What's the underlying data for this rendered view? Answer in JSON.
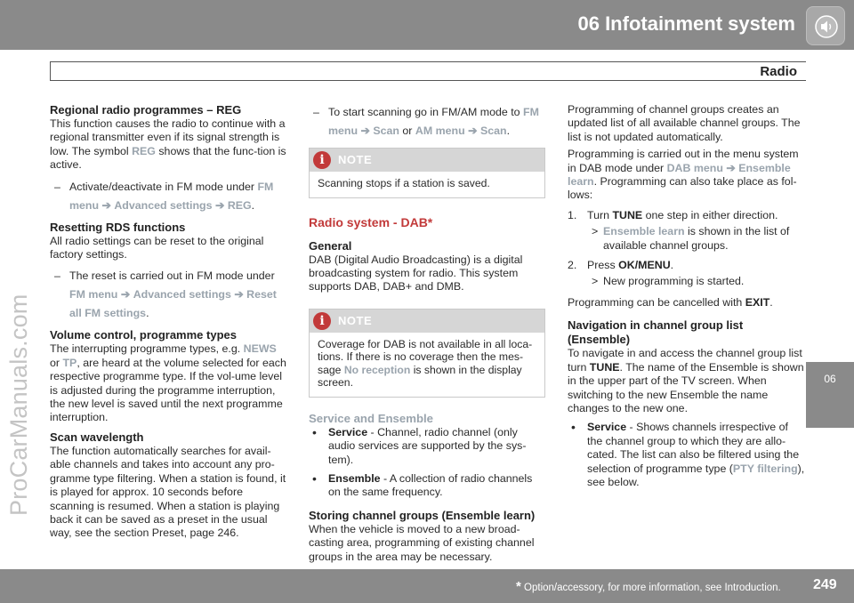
{
  "header": {
    "chapter_title": "06 Infotainment system",
    "icon": "speaker-icon"
  },
  "section": {
    "title": "Radio"
  },
  "side_tab": {
    "label": "06"
  },
  "watermark": "ProCarManuals.com",
  "footer": {
    "star": "*",
    "note": " Option/accessory, for more information, see Introduction.",
    "page": "249"
  },
  "col1": {
    "h_reg": "Regional radio programmes – REG",
    "reg_p1": "This function causes the radio to continue with a regional transmitter even if its signal strength is low. The symbol ",
    "reg_hl": "REG",
    "reg_p2": " shows that the func-tion is active.",
    "reg_item_a": "Activate/deactivate in FM mode under ",
    "reg_item_fm": "FM menu",
    "reg_item_adv": "Advanced settings",
    "reg_item_reg": "REG",
    "reg_item_end": ".",
    "h_rds": "Resetting RDS functions",
    "rds_p": "All radio settings can be reset to the original factory settings.",
    "rds_item_a": "The reset is carried out in FM mode under ",
    "rds_item_fm": "FM menu",
    "rds_item_adv": "Advanced settings",
    "rds_item_reset": "Reset all FM settings",
    "rds_item_end": ".",
    "h_vol": "Volume control, programme types",
    "vol_p1": "The interrupting programme types, e.g. ",
    "vol_news": "NEWS",
    "vol_or": " or ",
    "vol_tp": "TP",
    "vol_p2": ", are heard at the volume selected for each respective programme type. If the vol-ume level is adjusted during the programme interruption, the new level is saved until the next programme interruption.",
    "h_scan": "Scan wavelength",
    "scan_p": "The function automatically searches for avail-able channels and takes into account any pro-gramme type filtering. When a station is found, it is played for approx. 10 seconds before scanning is resumed. When a station is playing back it can be saved as a preset in the usual way, see the section Preset, page 246."
  },
  "col2": {
    "scan_item_a": "To start scanning go in FM/AM mode to ",
    "scan_fm": "FM menu",
    "scan_scan": "Scan",
    "scan_or": " or ",
    "scan_am": "AM menu",
    "scan_scan2": "Scan",
    "scan_end": ".",
    "note_label": "NOTE",
    "note1": "Scanning stops if a station is saved.",
    "h_dab": "Radio system - DAB*",
    "h_general": "General",
    "general_p": "DAB (Digital Audio Broadcasting) is a digital broadcasting system for radio. This system supports DAB, DAB+ and DMB.",
    "note2_a": "Coverage for DAB is not available in all loca-tions. If there is no coverage then the mes-sage ",
    "note2_hl": "No reception",
    "note2_b": " is shown in the display screen.",
    "h_service": "Service and Ensemble",
    "svc_term": "Service",
    "svc_desc": " - Channel, radio channel (only audio services are supported by the sys-tem).",
    "ens_term": "Ensemble",
    "ens_desc": " - A collection of radio channels on the same frequency.",
    "h_storing": "Storing channel groups (Ensemble learn)",
    "storing_p": "When the vehicle is moved to a new broad-casting area, programming of existing channel groups in the area may be necessary."
  },
  "col3": {
    "p1": "Programming of channel groups creates an updated list of all available channel groups. The list is not updated automatically.",
    "p2_a": "Programming is carried out in the menu system in DAB mode under ",
    "p2_dab": "DAB menu",
    "p2_ens": "Ensemble learn",
    "p2_b": ". Programming can also take place as fol-lows:",
    "step1_num": "1.",
    "step1_a": "Turn ",
    "step1_b": "TUNE",
    "step1_c": " one step in either direction.",
    "step1_sub_hl": "Ensemble learn",
    "step1_sub": " is shown in the list of available channel groups.",
    "step2_num": "2.",
    "step2_a": "Press ",
    "step2_b": "OK/MENU",
    "step2_c": ".",
    "step2_sub": "New programming is started.",
    "cancel_a": "Programming can be cancelled with ",
    "cancel_b": "EXIT",
    "cancel_c": ".",
    "h_nav": "Navigation in channel group list (Ensemble)",
    "nav_a": "To navigate in and access the channel group list turn ",
    "nav_b": "TUNE",
    "nav_c": ". The name of the Ensemble is shown in the upper part of the TV screen. When switching to the new Ensemble the name changes to the new one.",
    "svc_term": "Service",
    "svc_a": " - Shows channels irrespective of the channel group to which they are allo-cated. The list can also be filtered using the selection of programme type (",
    "svc_pty": "PTY filtering",
    "svc_b": "), see below."
  }
}
